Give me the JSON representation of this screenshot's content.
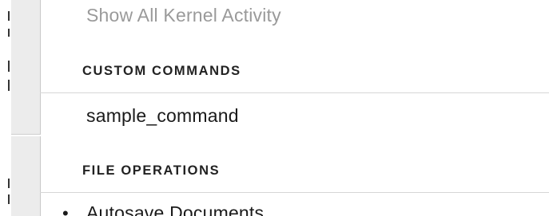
{
  "menu": {
    "show_all_kernel_activity": "Show All Kernel Activity",
    "custom_commands_header": "CUSTOM COMMANDS",
    "sample_command": "sample_command",
    "file_operations_header": "FILE OPERATIONS",
    "autosave_documents": "Autosave Documents",
    "autosave_bullet": "•"
  }
}
